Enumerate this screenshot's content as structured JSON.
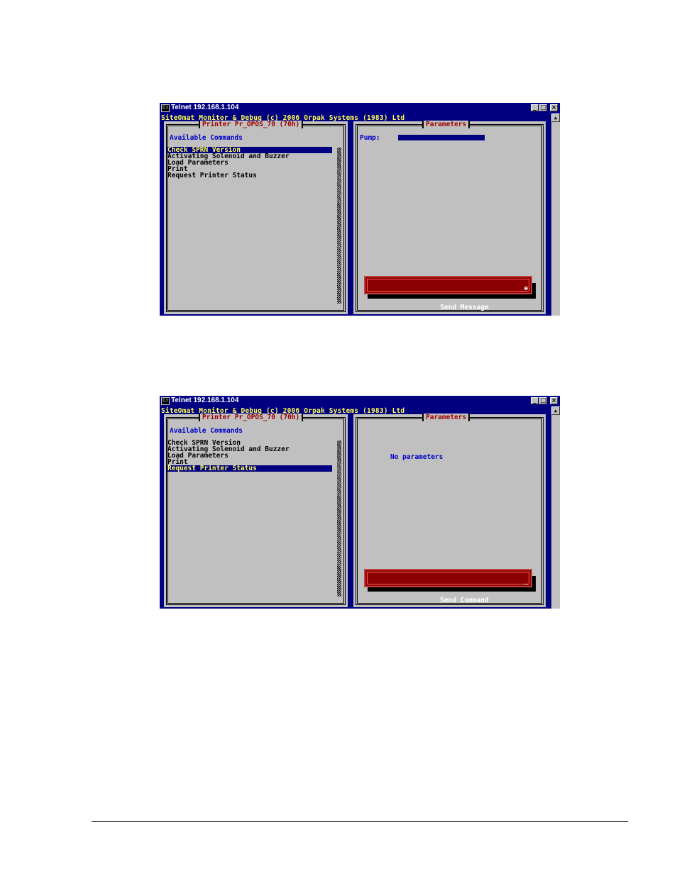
{
  "screens": [
    {
      "title": "Telnet 192.168.1.104",
      "headline": "SiteOmat Monitor & Debug (c) 2006 Orpak Systems (1983) Ltd",
      "left_panel_title": "Printer Pr_OPOS_70 (70h)",
      "available_label": "Available Commands",
      "commands": [
        "Check SPRN Version",
        "Activating Solenoid and Buzzer",
        "Load Parameters",
        "Print",
        "Request Printer Status"
      ],
      "selected_index": 0,
      "right_panel_title": "Parameters",
      "param_label": "Pump:",
      "button_label": "Send Message",
      "button_cursor": "e"
    },
    {
      "title": "Telnet 192.168.1.104",
      "headline": "SiteOmat Monitor & Debug (c) 2006 Orpak Systems (1983) Ltd",
      "left_panel_title": "Printer Pr_OPOS_70 (70h)",
      "available_label": "Available Commands",
      "commands": [
        "Check SPRN Version",
        "Activating Solenoid and Buzzer",
        "Load Parameters",
        "Print",
        "Request Printer Status"
      ],
      "selected_index": 4,
      "right_panel_title": "Parameters",
      "no_params_text": "No parameters",
      "button_label": "Send Command",
      "button_cursor": "_"
    }
  ],
  "window_controls": {
    "minimize": "_",
    "maximize": "□",
    "close": "×"
  },
  "scroll_arrow": "▲",
  "colors": {
    "console_bg": "#000080",
    "panel_bg": "#c0c0c0",
    "highlight_text": "#ffff54",
    "title_red": "#a00000",
    "label_blue": "#0000c8",
    "button_red": "#8b0000"
  }
}
